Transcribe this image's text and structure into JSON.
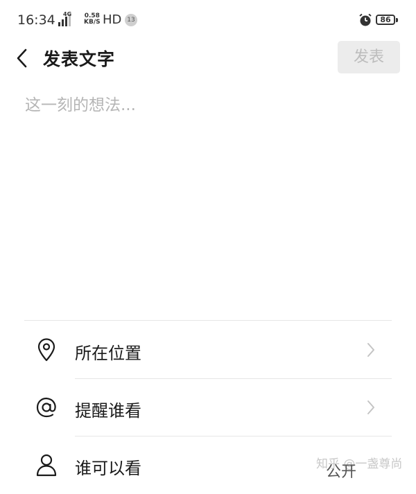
{
  "status_bar": {
    "time": "16:34",
    "network": "4G",
    "speed_value": "0.58",
    "speed_unit": "KB/S",
    "hd": "HD",
    "badge": "13",
    "battery": "86"
  },
  "header": {
    "title": "发表文字",
    "publish_label": "发表"
  },
  "composer": {
    "placeholder": "这一刻的想法...",
    "value": ""
  },
  "options": [
    {
      "icon": "location-pin-icon",
      "label": "所在位置"
    },
    {
      "icon": "at-sign-icon",
      "label": "提醒谁看"
    },
    {
      "icon": "person-icon",
      "label": "谁可以看",
      "value": "公开"
    }
  ],
  "watermark": "知乎 @一盏尊尚"
}
